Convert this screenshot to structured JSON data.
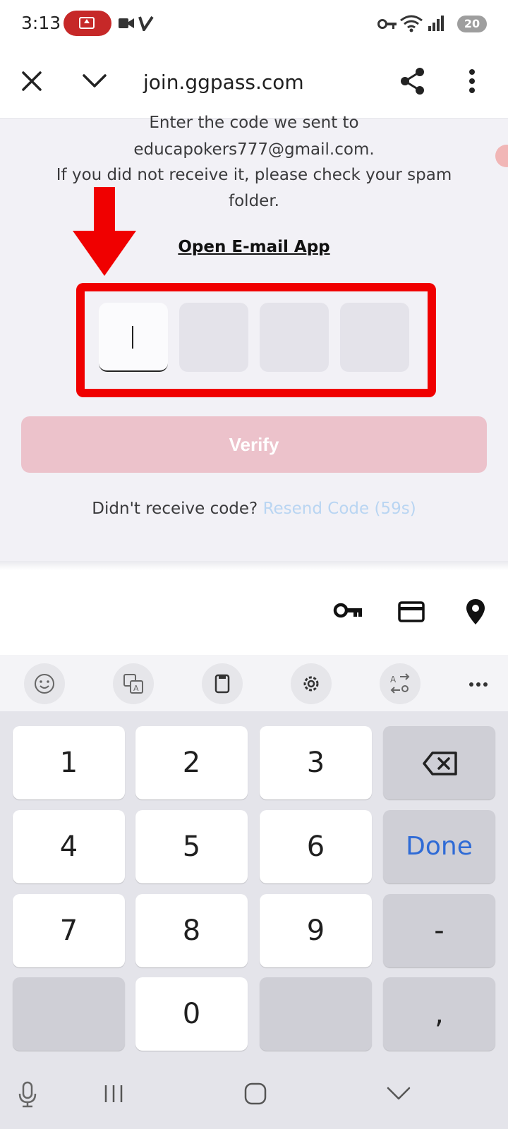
{
  "status_bar": {
    "time": "3:13",
    "battery": "20"
  },
  "browser": {
    "url": "join.ggpass.com"
  },
  "page": {
    "line1": "Enter the code we sent to",
    "email": "educapokers777@gmail.com.",
    "line3": "If you did not receive it, please check your spam",
    "line4": "folder.",
    "open_mail_label": "Open E-mail App",
    "verify_label": "Verify",
    "resend_prompt": "Didn't receive code?",
    "resend_label": "Resend Code (59s)"
  },
  "keyboard": {
    "keys": [
      "1",
      "2",
      "3",
      "4",
      "5",
      "6",
      "7",
      "8",
      "9",
      "0"
    ],
    "done_label": "Done",
    "dash_label": "-",
    "comma_label": ","
  },
  "colors": {
    "annotation_red": "#f00000",
    "verify_disabled": "#ecc2cb",
    "resend_disabled": "#b9d5f2",
    "done_blue": "#2f6bd6"
  }
}
